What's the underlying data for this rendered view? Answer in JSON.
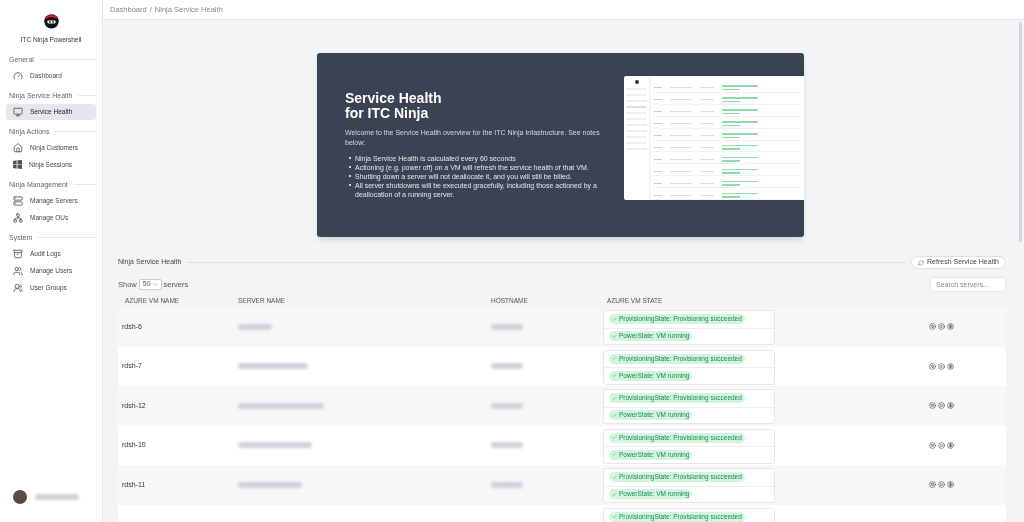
{
  "sidebar": {
    "app_title": "ITC Ninja Powershell",
    "sections": [
      {
        "heading": "General",
        "items": [
          {
            "label": "Dashboard",
            "selected": false
          }
        ]
      },
      {
        "heading": "Ninja Service Health",
        "items": [
          {
            "label": "Service Health",
            "selected": true
          }
        ]
      },
      {
        "heading": "Ninja Actions",
        "items": [
          {
            "label": "Ninja Customers",
            "selected": false
          },
          {
            "label": "Ninja Sessions",
            "selected": false
          }
        ]
      },
      {
        "heading": "Ninja Management",
        "items": [
          {
            "label": "Manage Servers",
            "selected": false
          },
          {
            "label": "Manage OUs",
            "selected": false
          }
        ]
      },
      {
        "heading": "System",
        "items": [
          {
            "label": "Audit Logs",
            "selected": false
          },
          {
            "label": "Manage Users",
            "selected": false
          },
          {
            "label": "User Groups",
            "selected": false
          }
        ]
      }
    ]
  },
  "breadcrumb": {
    "separator": "/",
    "items": [
      "Dashboard",
      "Ninja Service Health"
    ]
  },
  "banner": {
    "title_lines": [
      "Service Health",
      "for ITC Ninja"
    ],
    "intro": "Welcome to the Service Health overview for the ITC Ninja Infastructure. See notes below:",
    "notes": [
      "Ninja Service Health is calculated every 60 seconds",
      "Actioning (e.g. power off) on a VM will refresh the service health of that VM.",
      "Shutting down a server will not deallocate it, and you will still be billed.",
      "All server shutdowns will be executed gracefully, including those actioned by a deallocation of a running server."
    ]
  },
  "section": {
    "title": "Ninja Service Health",
    "refresh_button": "Refresh Service Health",
    "show_label": "Show",
    "page_size": "50",
    "show_suffix": "servers",
    "search_placeholder": "Search servers..."
  },
  "table": {
    "columns": [
      "AZURE VM NAME",
      "SERVER NAME",
      "HOSTNAME",
      "AZURE VM STATE"
    ],
    "rows": [
      {
        "vm_name": "rdsh-6",
        "states": [
          "ProvisioningState: Provisioning succeeded",
          "PowerState: VM running"
        ]
      },
      {
        "vm_name": "rdsh-7",
        "states": [
          "ProvisioningState: Provisioning succeeded",
          "PowerState: VM running"
        ]
      },
      {
        "vm_name": "rdsh-12",
        "states": [
          "ProvisioningState: Provisioning succeeded",
          "PowerState: VM running"
        ]
      },
      {
        "vm_name": "rdsh-10",
        "states": [
          "ProvisioningState: Provisioning succeeded",
          "PowerState: VM running"
        ]
      },
      {
        "vm_name": "rdsh-11",
        "states": [
          "ProvisioningState: Provisioning succeeded",
          "PowerState: VM running"
        ]
      },
      {
        "states": [
          "ProvisioningState: Provisioning succeeded"
        ]
      }
    ]
  }
}
